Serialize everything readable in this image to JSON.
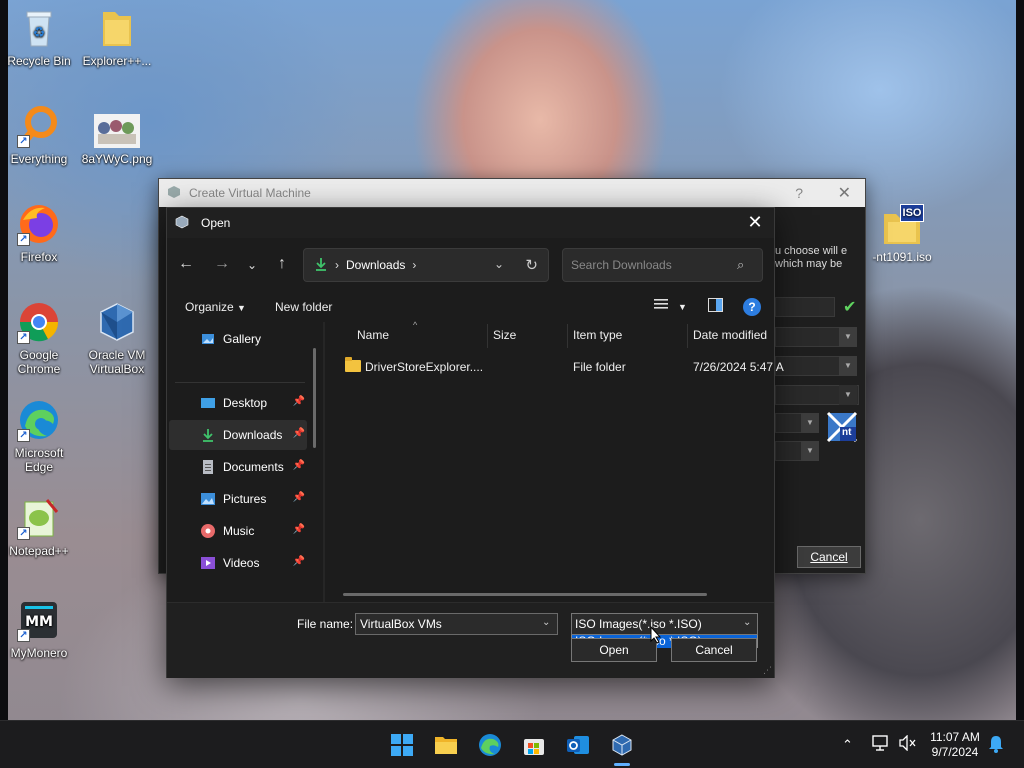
{
  "desktop": {
    "icons": [
      {
        "label": "Recycle Bin"
      },
      {
        "label": "Explorer++..."
      },
      {
        "label": "Everything"
      },
      {
        "label": "8aYWyC.png"
      },
      {
        "label": "Firefox"
      },
      {
        "label": "Google Chrome"
      },
      {
        "label": "Oracle VM VirtualBox"
      },
      {
        "label": "Microsoft Edge"
      },
      {
        "label": "Notepad++"
      },
      {
        "label": "MyMonero"
      }
    ],
    "iso_file": {
      "label": "-nt1091.iso",
      "badge": "ISO"
    }
  },
  "vbox_dialog": {
    "title": "Create Virtual Machine",
    "help": "?",
    "close": "✕",
    "side_text": "u choose will e which may be",
    "cancel_label": "Cancel",
    "badge": "nt"
  },
  "open_dialog": {
    "title": "Open",
    "close": "✕",
    "address": {
      "location": "Downloads"
    },
    "search_placeholder": "Search Downloads",
    "commands": {
      "organize": "Organize",
      "new_folder": "New folder"
    },
    "nav_items": [
      {
        "label": "Gallery"
      },
      {
        "label": "Desktop"
      },
      {
        "label": "Downloads"
      },
      {
        "label": "Documents"
      },
      {
        "label": "Pictures"
      },
      {
        "label": "Music"
      },
      {
        "label": "Videos"
      }
    ],
    "columns": {
      "name": "Name",
      "size": "Size",
      "type": "Item type",
      "date": "Date modified"
    },
    "rows": [
      {
        "name": "DriverStoreExplorer....",
        "size": "",
        "type": "File folder",
        "date": "7/26/2024 5:47 A"
      }
    ],
    "file_name_label": "File name:",
    "file_name_value": "VirtualBox VMs",
    "filter_selected": "ISO Images(*.iso *.ISO)",
    "filter_option": "ISO Images(*.iso *.ISO)",
    "open_label": "Open",
    "cancel_label": "Cancel"
  },
  "taskbar": {
    "time": "11:07 AM",
    "date": "9/7/2024"
  },
  "colors": {
    "accent": "#0a64d8",
    "folder": "#f3c33f",
    "dark_bg": "#1c1c1c"
  }
}
